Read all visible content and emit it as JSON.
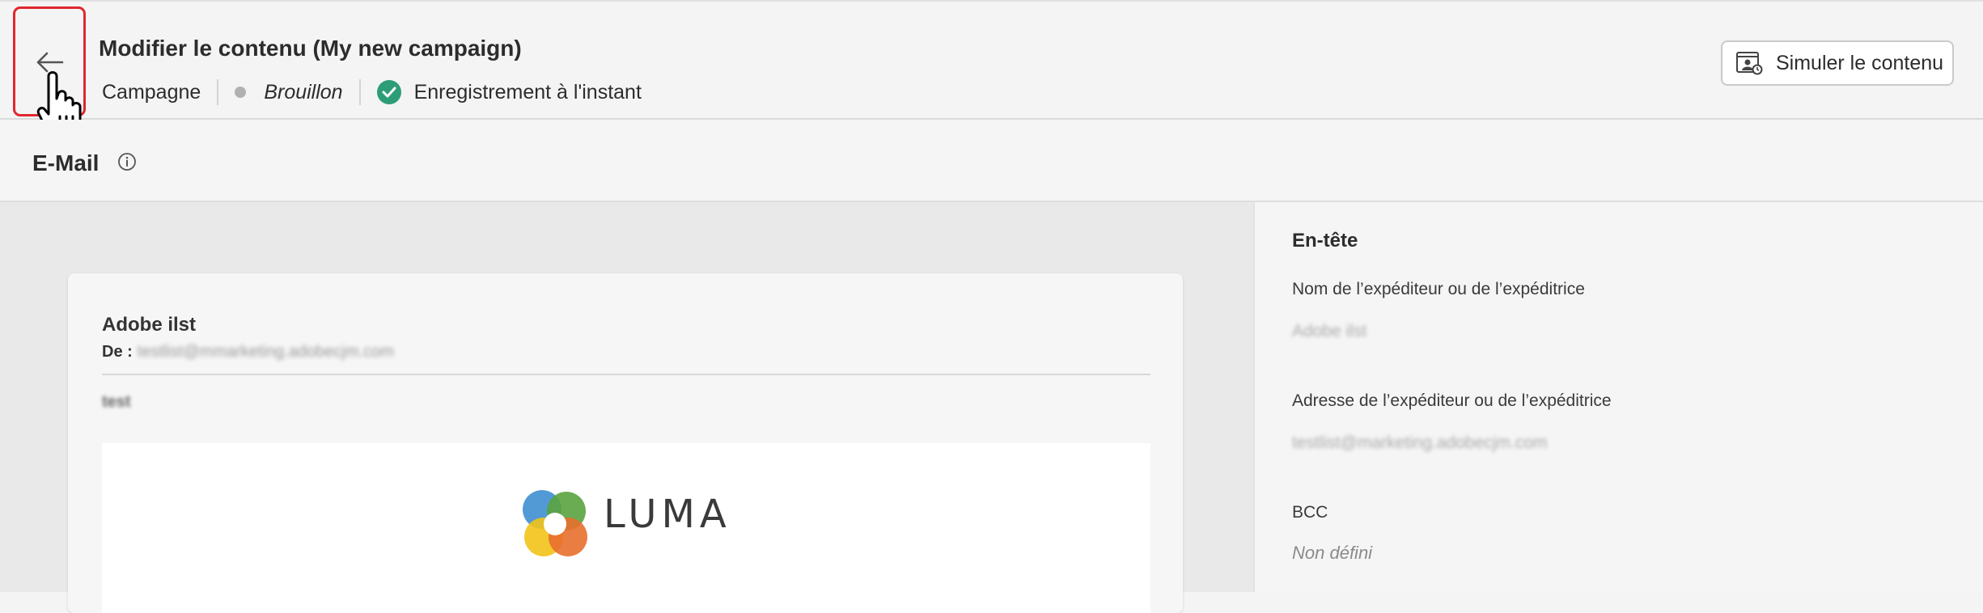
{
  "header": {
    "title": "Modifier le contenu (My new campaign)",
    "breadcrumb": "Campagne",
    "status": "Brouillon",
    "save_status": "Enregistrement à l'instant",
    "simulate_label": "Simuler le contenu",
    "status_colors": {
      "draft": "#b1b1b1",
      "saved": "#2d9d78"
    }
  },
  "section": {
    "title": "E-Mail"
  },
  "preview": {
    "sender_name": "Adobe ilst",
    "from_label": "De :",
    "from_value": "testlist@mmarketing.adobecjm.com",
    "subject": "test",
    "logo_text": "LUMA"
  },
  "panel": {
    "title": "En-tête",
    "fields": [
      {
        "label": "Nom de l’expéditeur ou de l’expéditrice",
        "value": "Adobe ilst"
      },
      {
        "label": "Adresse de l’expéditeur ou de l’expéditrice",
        "value": "testlist@marketing.adobecjm.com"
      },
      {
        "label": "BCC",
        "value": "Non défini"
      }
    ]
  },
  "accent": {
    "highlight_border": "#e0262e"
  }
}
